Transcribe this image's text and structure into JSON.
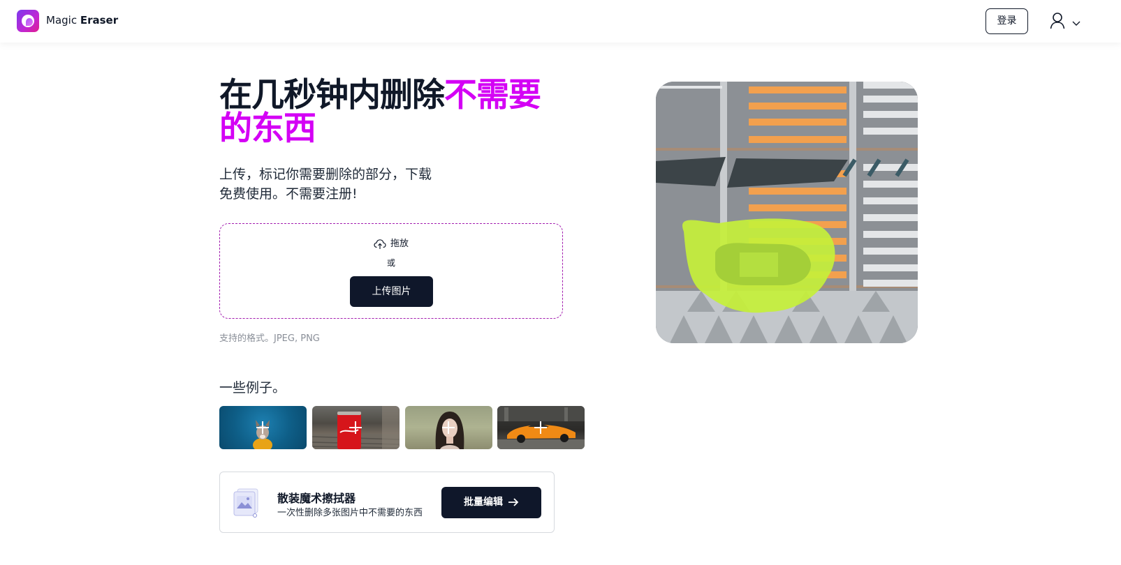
{
  "header": {
    "brand_prefix": "Magic",
    "brand_bold": "Eraser",
    "login_label": "登录",
    "logo_icon": "magic-eraser-logo",
    "user_icon": "user-icon",
    "chevron_icon": "chevron-down-icon"
  },
  "hero": {
    "title_main": "在几秒钟内删除",
    "title_accent_1": "不需要",
    "title_accent_2": "的东西",
    "subtitle_line1": "上传，标记你需要删除的部分，下载",
    "subtitle_line2": "免费使用。不需要注册!",
    "accent_color": "#d400f5"
  },
  "upload": {
    "drag_label": "拖放",
    "or_label": "或",
    "button_label": "上传图片",
    "formats": "支持的格式。JPEG, PNG"
  },
  "examples": {
    "title": "一些例子。",
    "items": [
      {
        "name": "dog-example"
      },
      {
        "name": "cola-example"
      },
      {
        "name": "woman-example"
      },
      {
        "name": "car-example"
      }
    ]
  },
  "bulk": {
    "title": "散装魔术擦拭器",
    "description": "一次性删除多张图片中不需要的东西",
    "button_label": "批量编辑"
  },
  "colors": {
    "dark": "#0f172a",
    "highlight": "#c6f03a"
  }
}
